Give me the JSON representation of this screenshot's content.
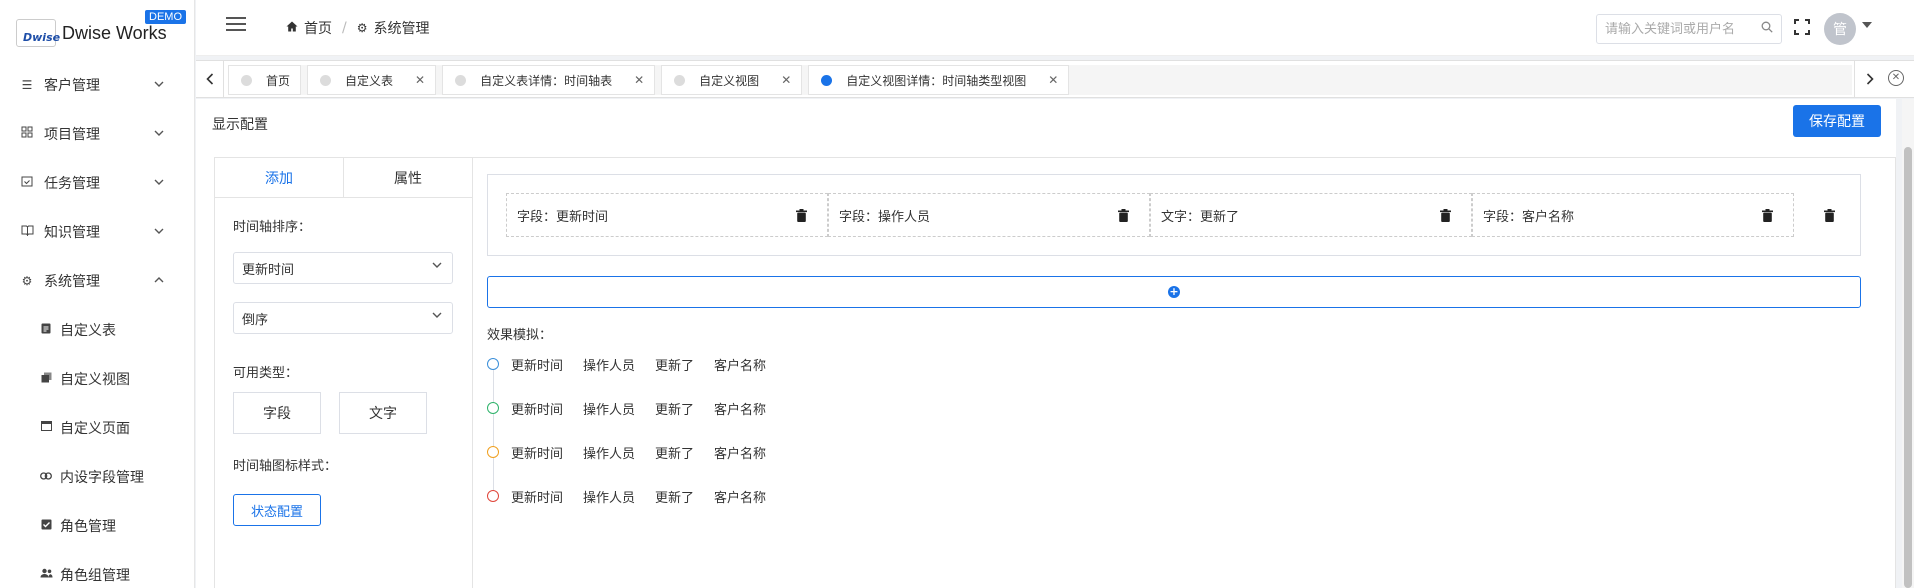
{
  "brand": {
    "logo_mark": "Dwise",
    "name": "Dwise Works",
    "badge": "DEMO"
  },
  "sidebar": {
    "items": [
      {
        "label": "客户管理",
        "icon": "list-icon",
        "expanded": false
      },
      {
        "label": "项目管理",
        "icon": "grid-icon",
        "expanded": false
      },
      {
        "label": "任务管理",
        "icon": "calendar-check-icon",
        "expanded": false
      },
      {
        "label": "知识管理",
        "icon": "book-icon",
        "expanded": false
      },
      {
        "label": "系统管理",
        "icon": "gear-icon",
        "expanded": true
      }
    ],
    "sub_items": [
      {
        "label": "自定义表",
        "icon": "document-icon"
      },
      {
        "label": "自定义视图",
        "icon": "layers-icon"
      },
      {
        "label": "自定义页面",
        "icon": "window-icon"
      },
      {
        "label": "内设字段管理",
        "icon": "link-icon"
      },
      {
        "label": "角色管理",
        "icon": "checkbox-icon"
      },
      {
        "label": "角色组管理",
        "icon": "users-icon"
      }
    ]
  },
  "header": {
    "breadcrumb": [
      {
        "label": "首页",
        "icon": "home-icon"
      },
      {
        "label": "系统管理",
        "icon": "gear-icon"
      }
    ],
    "search": {
      "placeholder": "请输入关键词或用户名",
      "value": ""
    },
    "avatar_text": "管"
  },
  "tabs": [
    {
      "label": "首页",
      "closable": false,
      "active": false
    },
    {
      "label": "自定义表",
      "closable": true,
      "active": false
    },
    {
      "label": "自定义表详情：时间轴表",
      "closable": true,
      "active": false
    },
    {
      "label": "自定义视图",
      "closable": true,
      "active": false
    },
    {
      "label": "自定义视图详情：时间轴类型视图",
      "closable": true,
      "active": true
    }
  ],
  "main": {
    "title": "显示配置",
    "save_label": "保存配置",
    "left_panel": {
      "tabs": [
        "添加",
        "属性"
      ],
      "sort_label": "时间轴排序：",
      "sort_field": "更新时间",
      "sort_order": "倒序",
      "types_label": "可用类型：",
      "type_buttons": [
        "字段",
        "文字"
      ],
      "icon_style_label": "时间轴图标样式：",
      "status_config_label": "状态配置"
    },
    "fields": [
      "字段：更新时间",
      "字段：操作人员",
      "文字：更新了",
      "字段：客户名称"
    ],
    "effect_label": "效果模拟：",
    "timeline": [
      {
        "color": "#3b8fd9",
        "items": [
          "更新时间",
          "操作人员",
          "更新了",
          "客户名称"
        ]
      },
      {
        "color": "#2fb36b",
        "items": [
          "更新时间",
          "操作人员",
          "更新了",
          "客户名称"
        ]
      },
      {
        "color": "#f0a020",
        "items": [
          "更新时间",
          "操作人员",
          "更新了",
          "客户名称"
        ]
      },
      {
        "color": "#e0463b",
        "items": [
          "更新时间",
          "操作人员",
          "更新了",
          "客户名称"
        ]
      }
    ]
  },
  "colors": {
    "accent": "#1a73e8"
  }
}
